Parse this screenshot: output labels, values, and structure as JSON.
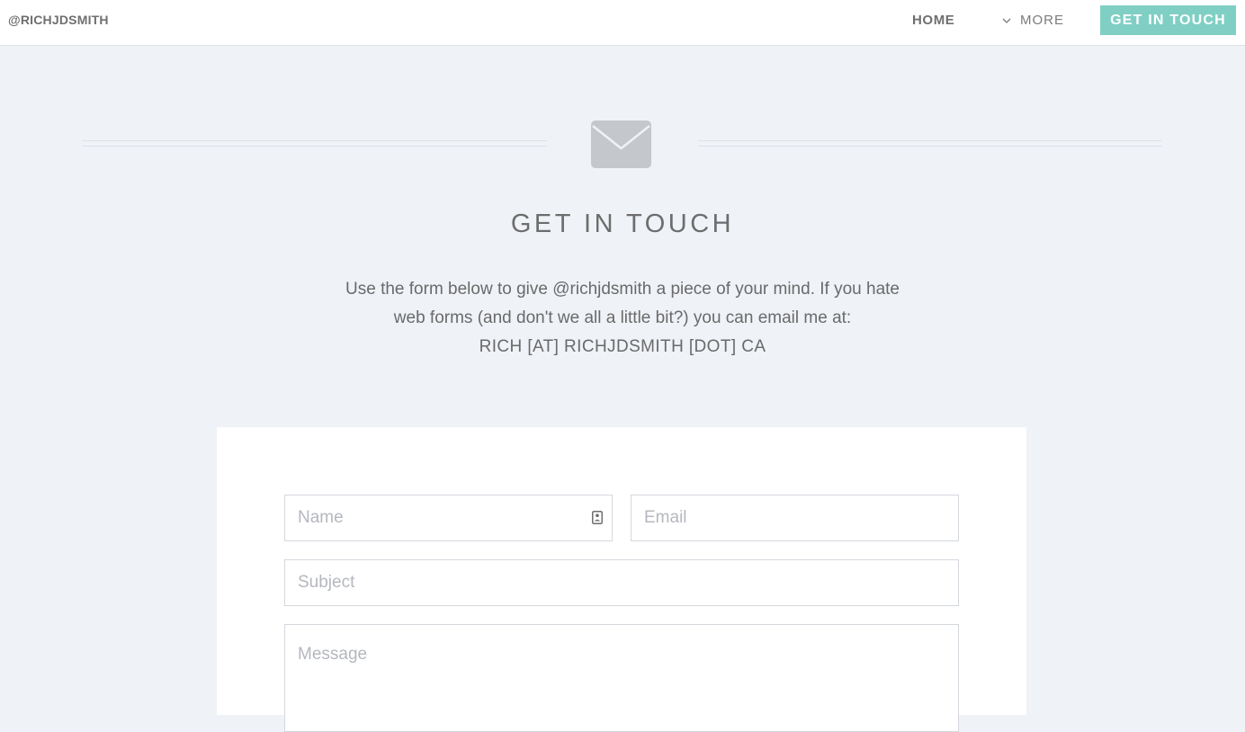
{
  "header": {
    "brand": "@RICHJDSMITH",
    "nav": {
      "home": "HOME",
      "more": "MORE",
      "cta": "GET IN TOUCH"
    }
  },
  "hero": {
    "icon": "envelope-icon",
    "title": "GET IN TOUCH",
    "intro_line1": "Use the form below to give @richjdsmith a piece of your mind. If you hate",
    "intro_line2": "web forms (and don't we all a little bit?) you can email me at:",
    "email_text": "RICH [AT] RICHJDSMITH [DOT] CA"
  },
  "form": {
    "name_placeholder": "Name",
    "email_placeholder": "Email",
    "subject_placeholder": "Subject",
    "message_placeholder": "Message",
    "name_icon": "contact-card-icon"
  },
  "colors": {
    "background": "#eff2f7",
    "accent": "#7fcfc4",
    "text": "#6c6c6c",
    "icon": "#c4c7cc"
  }
}
